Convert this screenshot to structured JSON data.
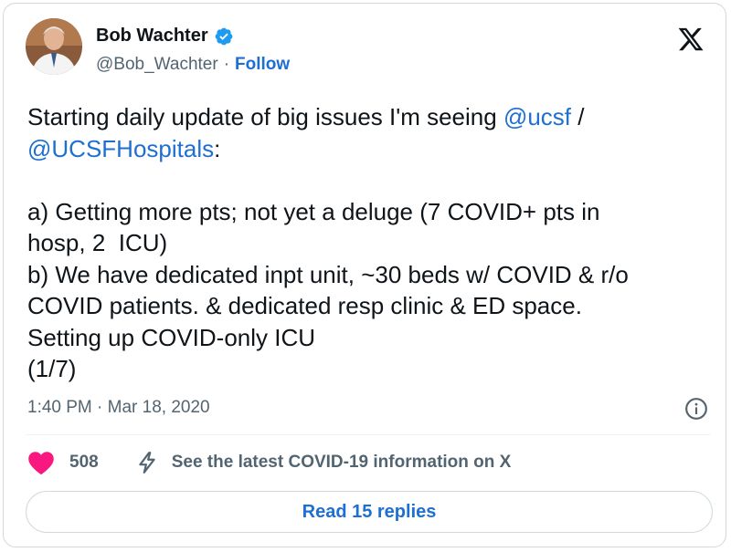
{
  "author": {
    "name": "Bob Wachter",
    "handle": "@Bob_Wachter",
    "separator": "·",
    "follow_label": "Follow"
  },
  "tweet": {
    "text_1": "Starting daily update of big issues I'm seeing ",
    "mention_1": "@ucsf",
    "text_2": " /\n",
    "mention_2": "@UCSFHospitals",
    "text_3": ":\n\na) Getting more pts; not yet a deluge (7 COVID+ pts in\nhosp, 2  ICU)\nb) We have dedicated inpt unit, ~30 beds w/ COVID & r/o\nCOVID patients. & dedicated resp clinic & ED space.\nSetting up COVID-only ICU\n(1/7)",
    "timestamp": "1:40 PM · Mar 18, 2020"
  },
  "actions": {
    "like_count": "508",
    "covid_info": "See the latest COVID-19 information on X"
  },
  "replies_button": "Read 15 replies",
  "colors": {
    "link": "#1d6fd1",
    "heart": "#f91880",
    "verified": "#1d9bf0",
    "muted": "#536471"
  },
  "icons": [
    "verified-badge-icon",
    "x-logo-icon",
    "info-icon",
    "heart-icon",
    "bolt-icon"
  ]
}
